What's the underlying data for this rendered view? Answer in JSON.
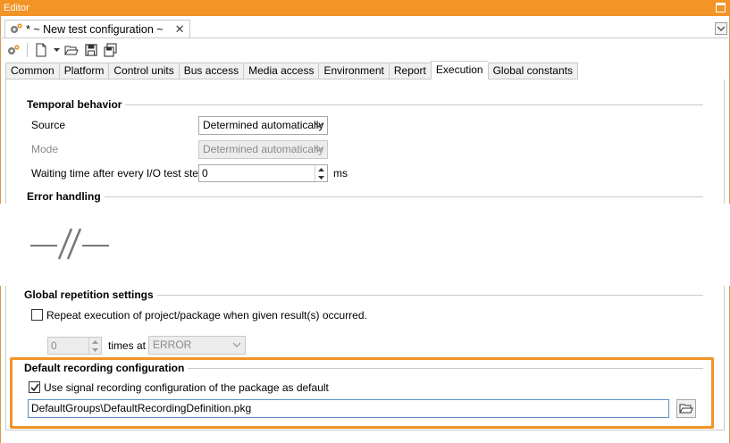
{
  "window": {
    "title": "Editor"
  },
  "doc_tab": {
    "label": "* ~ New test configuration ~",
    "close": "✕"
  },
  "tabs": [
    {
      "label": "Common"
    },
    {
      "label": "Platform"
    },
    {
      "label": "Control units"
    },
    {
      "label": "Bus access"
    },
    {
      "label": "Media access"
    },
    {
      "label": "Environment"
    },
    {
      "label": "Report"
    },
    {
      "label": "Execution"
    },
    {
      "label": "Global constants"
    }
  ],
  "active_tab": "Execution",
  "temporal": {
    "title": "Temporal behavior",
    "source_label": "Source",
    "source_value": "Determined automatically",
    "mode_label": "Mode",
    "mode_value": "Determined automatically",
    "wait_label": "Waiting time after every I/O test step",
    "wait_value": "0",
    "wait_unit": "ms"
  },
  "error_handling": {
    "title": "Error handling"
  },
  "global_repetition": {
    "title": "Global repetition settings",
    "repeat_label": "Repeat execution of project/package when given result(s) occurred.",
    "repeat_checked": false,
    "times_value": "0",
    "times_label": "times at",
    "result_value": "ERROR"
  },
  "recording": {
    "title": "Default recording configuration",
    "use_label": "Use signal recording configuration of the package as default",
    "use_checked": true,
    "path_value": "DefaultGroups\\DefaultRecordingDefinition.pkg"
  },
  "colors": {
    "accent": "#f29426",
    "input_focus": "#5b8fc7"
  },
  "icons": [
    "config-gear-icon",
    "new-document-icon",
    "open-folder-icon",
    "save-icon",
    "save-all-icon",
    "browse-folder-icon",
    "break-symbol-icon"
  ]
}
